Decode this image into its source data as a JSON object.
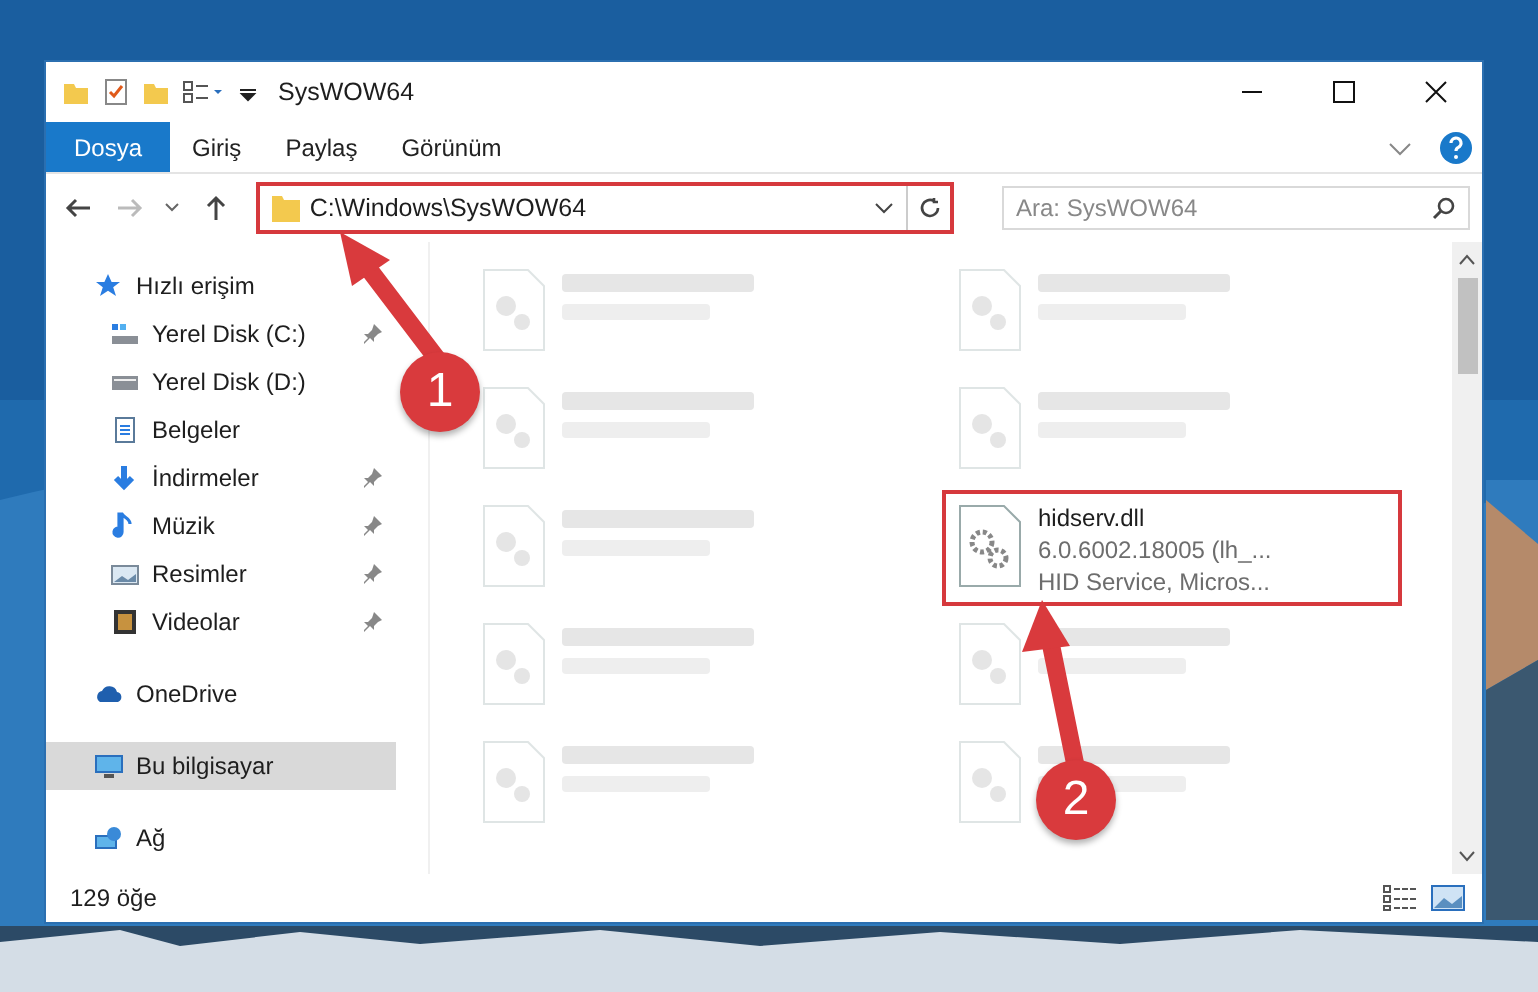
{
  "window": {
    "title": "SysWOW64"
  },
  "ribbon_tabs": [
    {
      "label": "Dosya",
      "kind": "file-menu"
    },
    {
      "label": "Giriş",
      "kind": "tab"
    },
    {
      "label": "Paylaş",
      "kind": "tab"
    },
    {
      "label": "Görünüm",
      "kind": "tab"
    }
  ],
  "address": {
    "path": "C:\\Windows\\SysWOW64",
    "highlighted": true
  },
  "search": {
    "placeholder": "Ara: SysWOW64"
  },
  "sidebar": {
    "items": [
      {
        "label": "Hızlı erişim",
        "kind": "star",
        "selected": false,
        "children": [
          {
            "label": "Yerel Disk (C:)",
            "kind": "drive-c",
            "pinned": true,
            "selected": false
          },
          {
            "label": "Yerel Disk (D:)",
            "kind": "drive",
            "pinned": false,
            "selected": false
          },
          {
            "label": "Belgeler",
            "kind": "documents",
            "pinned": false,
            "selected": false
          },
          {
            "label": "İndirmeler",
            "kind": "downloads",
            "pinned": true,
            "selected": false
          },
          {
            "label": "Müzik",
            "kind": "music",
            "pinned": true,
            "selected": false
          },
          {
            "label": "Resimler",
            "kind": "pictures",
            "pinned": true,
            "selected": false
          },
          {
            "label": "Videolar",
            "kind": "videos",
            "pinned": true,
            "selected": false
          }
        ]
      },
      {
        "label": "OneDrive",
        "kind": "cloud",
        "selected": false
      },
      {
        "label": "Bu bilgisayar",
        "kind": "computer",
        "selected": true
      },
      {
        "label": "Ağ",
        "kind": "network",
        "selected": false
      }
    ]
  },
  "files": [
    {
      "kind": "blurred"
    },
    {
      "kind": "blurred"
    },
    {
      "kind": "blurred"
    },
    {
      "kind": "blurred"
    },
    {
      "kind": "blurred"
    },
    {
      "kind": "file",
      "name": "hidserv.dll",
      "details": [
        "6.0.6002.18005 (lh_...",
        "HID Service, Micros..."
      ],
      "highlighted": true
    },
    {
      "kind": "blurred"
    },
    {
      "kind": "blurred"
    },
    {
      "kind": "blurred"
    },
    {
      "kind": "blurred"
    }
  ],
  "markers": [
    {
      "number": "1"
    },
    {
      "number": "2"
    }
  ],
  "status_bar": {
    "count": "129 öğe"
  }
}
